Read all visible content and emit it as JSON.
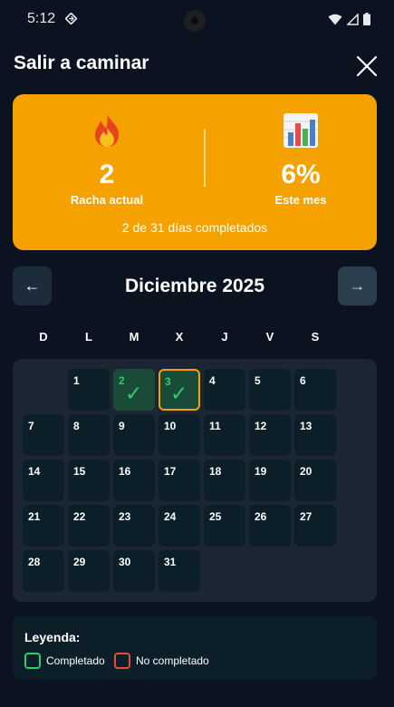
{
  "status_bar": {
    "time": "5:12"
  },
  "header": {
    "title": "Salir a caminar"
  },
  "stats": {
    "streak_value": "2",
    "streak_label": "Racha actual",
    "month_value": "6%",
    "month_label": "Este mes",
    "summary": "2 de 31 días completados",
    "streak_icon": "fire-icon",
    "month_icon": "bar-chart-icon",
    "card_color": "#f5a200"
  },
  "calendar": {
    "month_title": "Diciembre 2025",
    "prev_label": "←",
    "next_label": "→",
    "weekdays": [
      "D",
      "L",
      "M",
      "X",
      "J",
      "V",
      "S"
    ],
    "first_weekday_index": 1,
    "days_in_month": 31,
    "completed_days": [
      2,
      3
    ],
    "today": 3,
    "check_mark": "✓"
  },
  "legend": {
    "title": "Leyenda:",
    "items": [
      {
        "label": "Completado",
        "color": "#2ecc71"
      },
      {
        "label": "No completado",
        "color": "#e74c3c"
      }
    ]
  }
}
